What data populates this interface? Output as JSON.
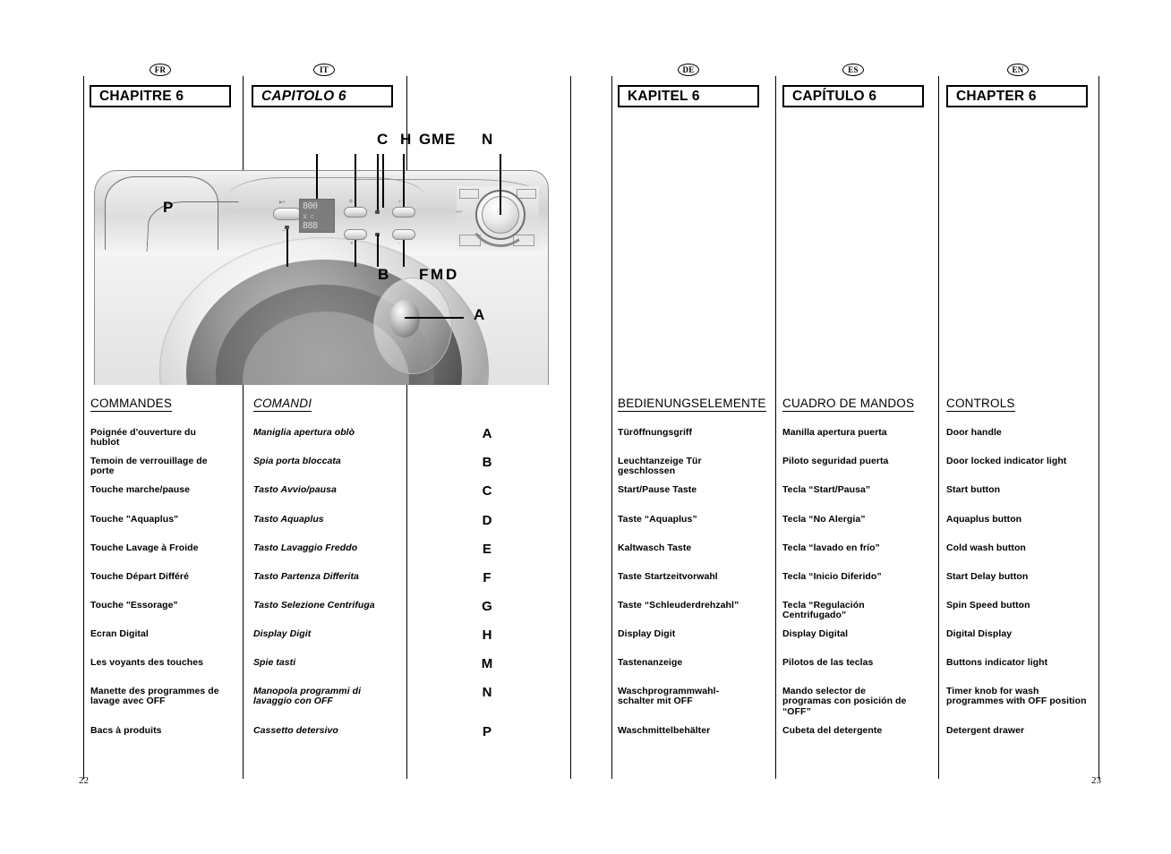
{
  "document": {
    "type": "washing-machine-user-manual-spread",
    "left_page_number": "22",
    "right_page_number": "23"
  },
  "languages": [
    {
      "code": "FR",
      "chapter": "CHAPITRE 6",
      "heading": "COMMANDES"
    },
    {
      "code": "IT",
      "chapter": "CAPITOLO 6",
      "heading": "COMANDI"
    },
    {
      "code": "DE",
      "chapter": "KAPITEL 6",
      "heading": "BEDIENUNGSELEMENTE"
    },
    {
      "code": "ES",
      "chapter": "CAPÍTULO 6",
      "heading": "CUADRO DE MANDOS"
    },
    {
      "code": "EN",
      "chapter": "CHAPTER 6",
      "heading": "CONTROLS"
    }
  ],
  "letters": [
    "A",
    "B",
    "C",
    "D",
    "E",
    "F",
    "G",
    "H",
    "M",
    "N",
    "P"
  ],
  "controls": {
    "fr": [
      "Poignée d'ouverture du\nhublot",
      "Temoin de verrouillage de\nporte",
      "Touche marche/pause",
      "Touche \"Aquaplus\"",
      "Touche Lavage à Froide",
      "Touche Départ Différé",
      "Touche \"Essorage\"",
      "Ecran Digital",
      "Les voyants des  touches",
      "Manette des programmes de\nlavage avec OFF",
      "Bacs à produits"
    ],
    "it": [
      "Maniglia apertura oblò",
      "Spia porta bloccata",
      "Tasto Avvio/pausa",
      "Tasto Aquaplus",
      "Tasto Lavaggio Freddo",
      "Tasto Partenza Differita",
      "Tasto Selezione Centrifuga",
      "Display Digit",
      "Spie tasti",
      "Manopola programmi di\nlavaggio con OFF",
      "Cassetto detersivo"
    ],
    "de": [
      "Türöffnungsgriff",
      "Leuchtanzeige Tür\ngeschlossen",
      "Start/Pause Taste",
      "Taste “Aquaplus”",
      "Kaltwasch Taste",
      "Taste Startzeitvorwahl",
      "Taste “Schleuderdrehzahl”",
      "Display Digit",
      "Tastenanzeige",
      "Waschprogrammwahl-\nschalter mit OFF",
      "Waschmittelbehälter"
    ],
    "es": [
      "Manilla apertura puerta",
      "Piloto seguridad puerta",
      "Tecla “Start/Pausa”",
      "Tecla “No Alergia”",
      "Tecla “lavado en frío”",
      "Tecla “Inicio Diferido”",
      "Tecla “Regulación\nCentrifugado”",
      "Display Digital",
      "Pilotos de las teclas",
      "Mando selector de\nprogramas con posición de\n“OFF”",
      "Cubeta del detergente"
    ],
    "en": [
      "Door handle",
      "Door locked indicator light",
      "Start button",
      "Aquaplus button",
      "Cold wash button",
      "Start Delay button",
      "Spin Speed button",
      "Digital Display",
      "Buttons indicator light",
      "Timer knob for wash\nprogrammes with OFF position",
      "Detergent drawer"
    ]
  },
  "diagram": {
    "callouts": [
      {
        "id": "C",
        "label": "C"
      },
      {
        "id": "H",
        "label": "H"
      },
      {
        "id": "G",
        "label": "G"
      },
      {
        "id": "M",
        "label": "M"
      },
      {
        "id": "E",
        "label": "E"
      },
      {
        "id": "N",
        "label": "N"
      },
      {
        "id": "P",
        "label": "P"
      },
      {
        "id": "B",
        "label": "B"
      },
      {
        "id": "F",
        "label": "F"
      },
      {
        "id": "M2",
        "label": "M"
      },
      {
        "id": "D",
        "label": "D"
      },
      {
        "id": "A",
        "label": "A"
      }
    ],
    "display_top": "800",
    "display_mid": "⊻ ⊂",
    "display_bottom": "888"
  },
  "colors": {
    "ink": "#000000",
    "paper": "#ffffff",
    "machine_body": "#e4e4e4",
    "display_bg": "#7d7d7d"
  }
}
